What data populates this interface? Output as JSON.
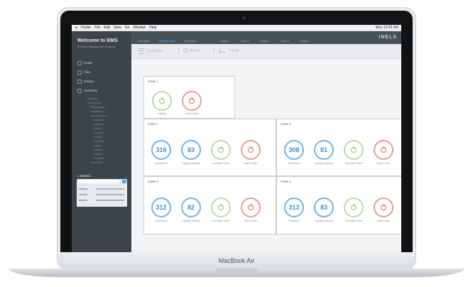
{
  "menubar": {
    "app": "Finder",
    "items": [
      "File",
      "Edit",
      "View",
      "Go",
      "Window",
      "Help"
    ],
    "status": "Mon 12:55 AM"
  },
  "sidebar": {
    "title": "Welcome to BMS",
    "subtitle": "Building Management System",
    "items": [
      "Home",
      "Files",
      "History",
      "Hierarchy"
    ],
    "search_label": "Search"
  },
  "topbar": {
    "tabs": [
      "Overview",
      "Ground Floor",
      "First floor",
      "Zone 1",
      "Zone 2",
      "Zone 3",
      "Zone 4",
      "Zone 5"
    ],
    "active_index": 1,
    "logo": "iNELS"
  },
  "subbar": {
    "links": [
      "Schedules",
      "Alarms",
      "Trends"
    ]
  },
  "zones": [
    {
      "name": "ZONE 1",
      "controls": [
        {
          "type": "green",
          "label": "Lighting"
        },
        {
          "type": "red",
          "label": "Hatch mode"
        }
      ]
    },
    {
      "name": "ZONE 2",
      "controls": [
        {
          "type": "value",
          "value": "316",
          "label": "Illuminance"
        },
        {
          "type": "value",
          "value": "83",
          "label": "Lighting intensity"
        },
        {
          "type": "green",
          "label": "Automatic mode"
        },
        {
          "type": "red",
          "label": "Hatch mode"
        }
      ]
    },
    {
      "name": "ZONE 3",
      "controls": [
        {
          "type": "value",
          "value": "308",
          "label": "Illuminance"
        },
        {
          "type": "value",
          "value": "81",
          "label": "Lighting intensity"
        },
        {
          "type": "green",
          "label": "Automatic mode"
        },
        {
          "type": "red",
          "label": "Hatch mode"
        }
      ]
    },
    {
      "name": "ZONE 4",
      "controls": [
        {
          "type": "value",
          "value": "312",
          "label": "Illuminance"
        },
        {
          "type": "value",
          "value": "82",
          "label": "Lighting intensity"
        },
        {
          "type": "green",
          "label": "Automatic mode"
        },
        {
          "type": "red",
          "label": "Hatch mode"
        }
      ]
    },
    {
      "name": "ZONE 5",
      "controls": [
        {
          "type": "value",
          "value": "313",
          "label": "Illuminance"
        },
        {
          "type": "value",
          "value": "83",
          "label": "Lighting intensity"
        },
        {
          "type": "green",
          "label": "Automatic mode"
        },
        {
          "type": "red",
          "label": "Hatch mode"
        }
      ]
    }
  ],
  "device": {
    "name": "MacBook Air"
  }
}
